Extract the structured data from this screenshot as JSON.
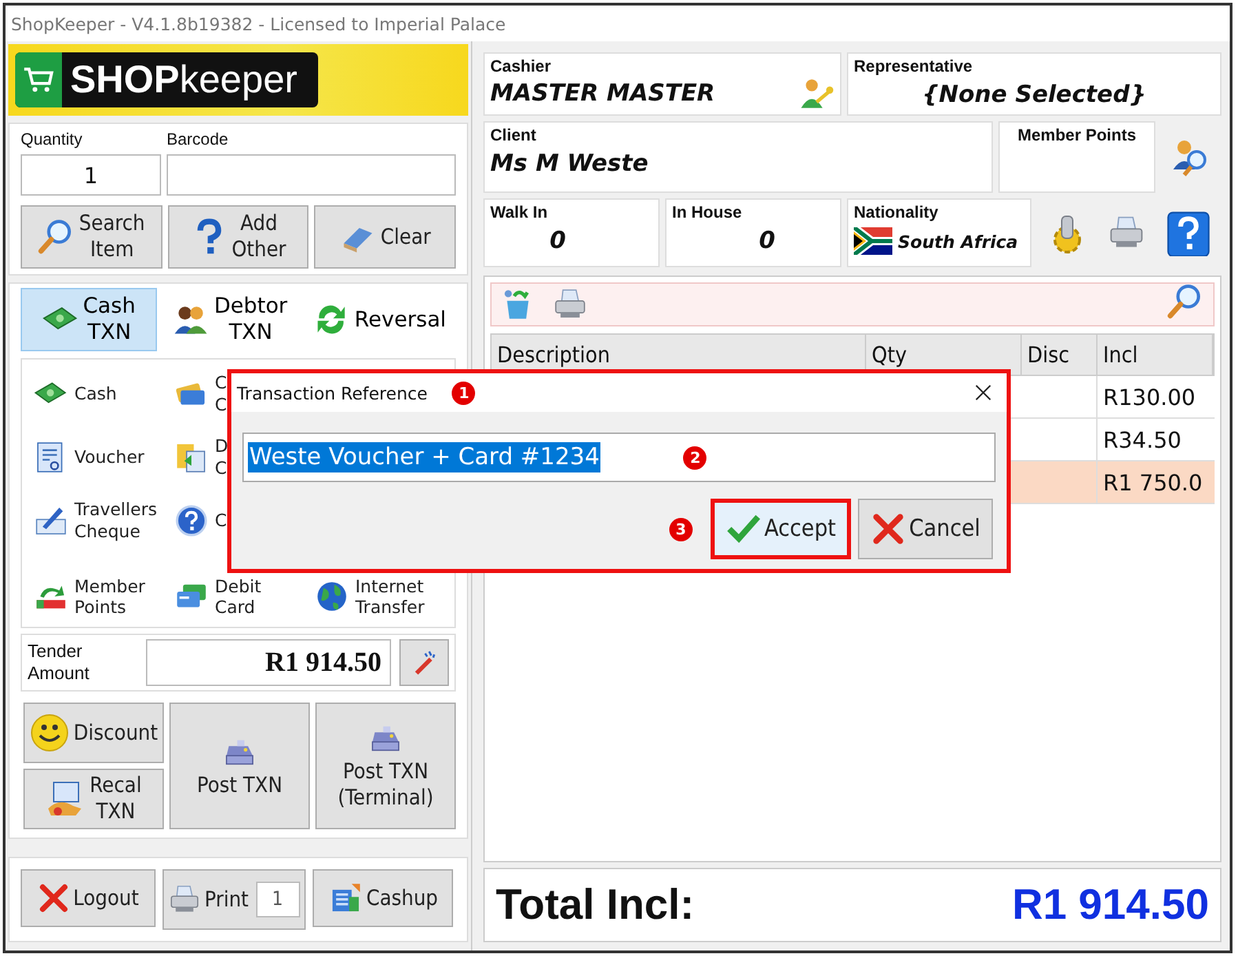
{
  "window": {
    "title": "ShopKeeper - V4.1.8b19382 - Licensed to Imperial Palace"
  },
  "logo": {
    "bold": "SHOP",
    "light": "keeper"
  },
  "entry": {
    "quantity_label": "Quantity",
    "quantity": "1",
    "barcode_label": "Barcode",
    "buttons": [
      {
        "lines": [
          "Search",
          "Item"
        ]
      },
      {
        "lines": [
          "Add",
          "Other"
        ]
      },
      {
        "lines": [
          "Clear"
        ]
      }
    ]
  },
  "txn_types": [
    {
      "lines": [
        "Cash",
        "TXN"
      ],
      "selected": true
    },
    {
      "lines": [
        "Debtor",
        "TXN"
      ],
      "selected": false
    },
    {
      "lines": [
        "Reversal"
      ],
      "selected": false
    }
  ],
  "tenders": [
    [
      {
        "kind": "cash",
        "lines": [
          "Cash"
        ]
      },
      {
        "kind": "card",
        "lines": [
          "C",
          "C"
        ]
      }
    ],
    [
      {
        "kind": "voucher",
        "lines": [
          "Voucher"
        ]
      },
      {
        "kind": "document",
        "lines": [
          "D",
          "C"
        ]
      }
    ],
    [
      {
        "kind": "cheque",
        "lines": [
          "Travellers",
          "Cheque"
        ]
      },
      {
        "kind": "help",
        "lines": [
          "C"
        ]
      }
    ],
    [
      {
        "kind": "points",
        "lines": [
          "Member",
          "Points"
        ]
      },
      {
        "kind": "debit",
        "lines": [
          "Debit",
          "Card"
        ]
      },
      {
        "kind": "globe",
        "lines": [
          "Internet",
          "Transfer"
        ]
      }
    ]
  ],
  "tender_amount": {
    "lines": [
      "Tender",
      "Amount"
    ],
    "value": "R1 914.50"
  },
  "actions": {
    "discount": [
      "Discount"
    ],
    "recall": [
      "Recal",
      "TXN"
    ],
    "post": [
      "Post TXN"
    ],
    "post_terminal": [
      "Post TXN",
      "(Terminal)"
    ]
  },
  "footer": {
    "logout": "Logout",
    "print": "Print",
    "copies": "1",
    "cashup": "Cashup"
  },
  "cashier": {
    "label": "Cashier",
    "value": "MASTER MASTER"
  },
  "representative": {
    "label": "Representative",
    "value": "{None Selected}"
  },
  "client": {
    "label": "Client",
    "value": "Ms M Weste"
  },
  "member_points": {
    "label": "Member Points"
  },
  "walk_in": {
    "label": "Walk In",
    "value": "0"
  },
  "in_house": {
    "label": "In House",
    "value": "0"
  },
  "nationality": {
    "label": "Nationality",
    "value": "South Africa"
  },
  "table": {
    "columns": [
      "Description",
      "Qty",
      "Disc",
      "Incl"
    ],
    "rows": [
      {
        "incl": "R130.00",
        "selected": false
      },
      {
        "incl": "R34.50",
        "selected": false
      },
      {
        "incl": "R1 750.0",
        "selected": true
      }
    ]
  },
  "total": {
    "label": "Total Incl:",
    "value": "R1 914.50"
  },
  "dialog": {
    "title": "Transaction Reference",
    "value": "Weste Voucher + Card #1234",
    "buttons": [
      {
        "kind": "accept",
        "label": "Accept",
        "highlighted": true
      },
      {
        "kind": "cancel",
        "label": "Cancel",
        "highlighted": false
      }
    ],
    "steps": [
      "1",
      "2",
      "3"
    ]
  }
}
